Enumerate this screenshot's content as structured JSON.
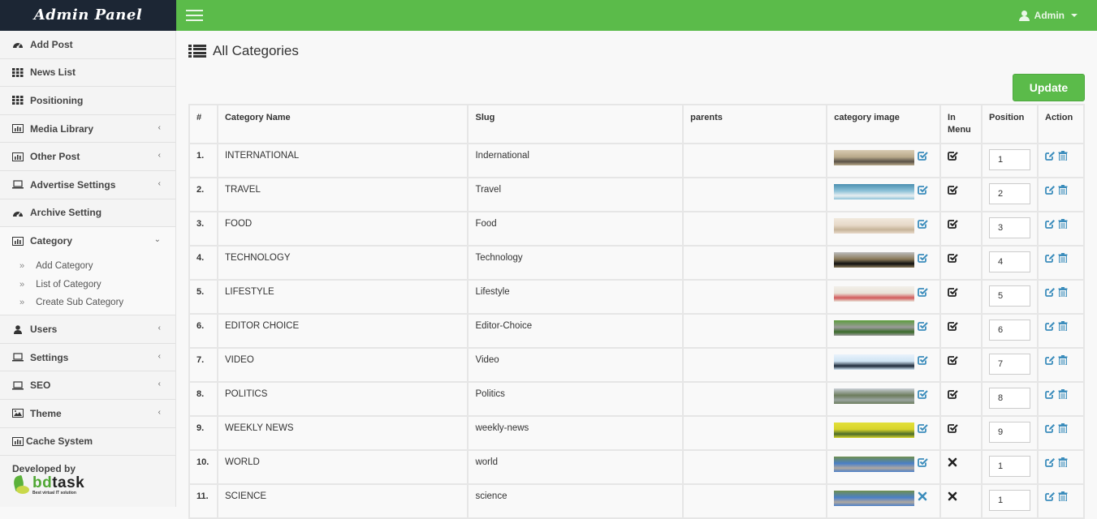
{
  "header": {
    "brand": "Admin Panel",
    "user_label": "Admin",
    "accent_color": "#5bbb4a",
    "brand_bg": "#1c2634"
  },
  "sidebar": {
    "items": [
      {
        "label": "Add Post",
        "icon": "dashboard-icon",
        "has_children": false
      },
      {
        "label": "News List",
        "icon": "grid-icon",
        "has_children": false
      },
      {
        "label": "Positioning",
        "icon": "grid-icon",
        "has_children": false
      },
      {
        "label": "Media Library",
        "icon": "bar-chart-icon",
        "has_children": true
      },
      {
        "label": "Other Post",
        "icon": "bar-chart-icon",
        "has_children": true
      },
      {
        "label": "Advertise Settings",
        "icon": "laptop-icon",
        "has_children": true
      },
      {
        "label": "Archive Setting",
        "icon": "dashboard-icon",
        "has_children": false
      },
      {
        "label": "Category",
        "icon": "bar-chart-icon",
        "has_children": true,
        "expanded": true,
        "children": [
          {
            "label": "Add Category"
          },
          {
            "label": "List of Category"
          },
          {
            "label": "Create Sub Category"
          }
        ]
      },
      {
        "label": "Users",
        "icon": "user-icon",
        "has_children": true
      },
      {
        "label": "Settings",
        "icon": "laptop-icon",
        "has_children": true
      },
      {
        "label": "SEO",
        "icon": "laptop-icon",
        "has_children": true
      },
      {
        "label": "Theme",
        "icon": "image-icon",
        "has_children": true
      },
      {
        "label": "Cache System",
        "icon": "bar-chart-icon",
        "has_children": false
      }
    ],
    "footer": {
      "developed_by": "Developed by",
      "logo_text_1": "bd",
      "logo_text_2": "task",
      "logo_tagline": "Best virtual IT solution"
    }
  },
  "main": {
    "title": "All Categories",
    "update_button": "Update",
    "table": {
      "columns": [
        "#",
        "Category Name",
        "Slug",
        "parents",
        "category image",
        "In Menu",
        "Position",
        "Action"
      ],
      "rows": [
        {
          "num": "1.",
          "name": "INTERNATIONAL",
          "slug": "Indernational",
          "parents": "",
          "image_status": "check",
          "in_menu": "check",
          "position": "1"
        },
        {
          "num": "2.",
          "name": "TRAVEL",
          "slug": "Travel",
          "parents": "",
          "image_status": "check",
          "in_menu": "check",
          "position": "2"
        },
        {
          "num": "3.",
          "name": "FOOD",
          "slug": "Food",
          "parents": "",
          "image_status": "check",
          "in_menu": "check",
          "position": "3"
        },
        {
          "num": "4.",
          "name": "TECHNOLOGY",
          "slug": "Technology",
          "parents": "",
          "image_status": "check",
          "in_menu": "check",
          "position": "4"
        },
        {
          "num": "5.",
          "name": "LIFESTYLE",
          "slug": "Lifestyle",
          "parents": "",
          "image_status": "check",
          "in_menu": "check",
          "position": "5"
        },
        {
          "num": "6.",
          "name": "EDITOR CHOICE",
          "slug": "Editor-Choice",
          "parents": "",
          "image_status": "check",
          "in_menu": "check",
          "position": "6"
        },
        {
          "num": "7.",
          "name": "VIDEO",
          "slug": "Video",
          "parents": "",
          "image_status": "check",
          "in_menu": "check",
          "position": "7"
        },
        {
          "num": "8.",
          "name": "POLITICS",
          "slug": "Politics",
          "parents": "",
          "image_status": "check",
          "in_menu": "check",
          "position": "8"
        },
        {
          "num": "9.",
          "name": "WEEKLY NEWS",
          "slug": "weekly-news",
          "parents": "",
          "image_status": "check",
          "in_menu": "check",
          "position": "9"
        },
        {
          "num": "10.",
          "name": "WORLD",
          "slug": "world",
          "parents": "",
          "image_status": "check",
          "in_menu": "cross",
          "position": "1"
        },
        {
          "num": "11.",
          "name": "SCIENCE",
          "slug": "science",
          "parents": "",
          "image_status": "cross",
          "in_menu": "cross",
          "position": "1"
        }
      ]
    }
  },
  "colors": {
    "icon_blue": "#3c8dbc",
    "thumbs": [
      [
        "#b9a98a",
        "#5a5247",
        "#d8cbb2"
      ],
      [
        "#8fc3d9",
        "#e7eef0",
        "#4a8fb0"
      ],
      [
        "#e7d9c9",
        "#c7b49a",
        "#f1e9dd"
      ],
      [
        "#8a7a5a",
        "#111111",
        "#bbbbbb"
      ],
      [
        "#e9e2d8",
        "#d25b5b",
        "#f2efe9"
      ],
      [
        "#9b9b9b",
        "#3b6b2a",
        "#5c9c3c"
      ],
      [
        "#cfe4f4",
        "#1d2a3a",
        "#e9f2fb"
      ],
      [
        "#6c7c5c",
        "#9aa5a0",
        "#c9cfd6"
      ],
      [
        "#d8d42a",
        "#4a6b2a",
        "#e3e03a"
      ],
      [
        "#4a7fc8",
        "#b0a8a0",
        "#6f8f4f"
      ],
      [
        "#4a7fc8",
        "#b0a8a0",
        "#6f8f4f"
      ]
    ]
  }
}
